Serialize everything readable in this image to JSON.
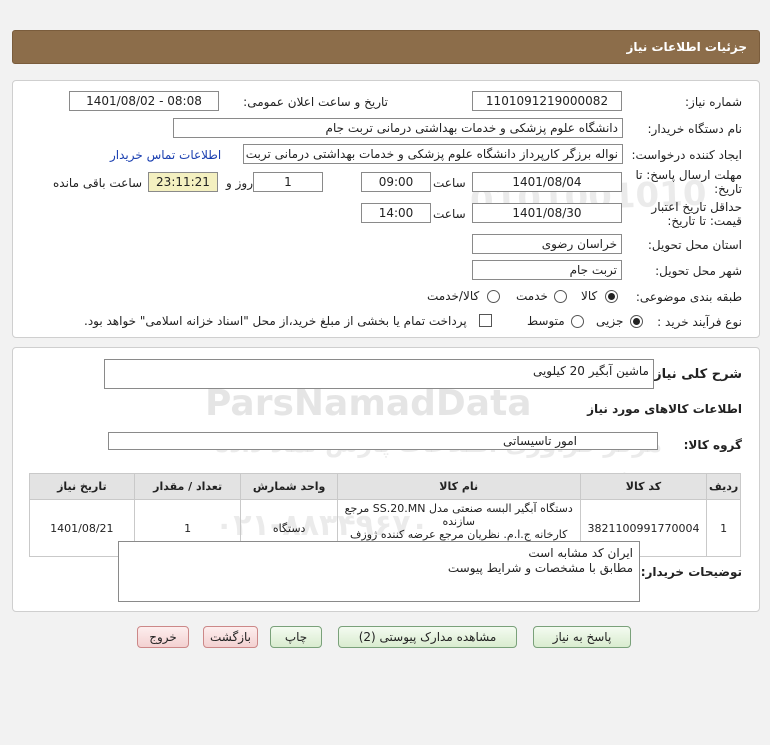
{
  "header": {
    "title": "جزئیات اطلاعات نیاز"
  },
  "details": {
    "need_number_label": "شماره نیاز:",
    "need_number": "1101091219000082",
    "announce_label": "تاریخ و ساعت اعلان عمومی:",
    "announce_value": "1401/08/02 - 08:08",
    "buyer_label": "نام دستگاه خریدار:",
    "buyer_value": "دانشگاه علوم پزشکی و خدمات بهداشتی  درمانی تربت جام",
    "creator_label": "ایجاد کننده درخواست:",
    "creator_value": "نواله برزگر کارپرداز دانشگاه علوم پزشکی و خدمات بهداشتی  درمانی تربت جام",
    "contact_link": "اطلاعات تماس خریدار",
    "deadline_label_1": "مهلت ارسال پاسخ: تا",
    "deadline_label_2": "تاریخ:",
    "deadline_date": "1401/08/04",
    "time_label": "ساعت",
    "deadline_time": "09:00",
    "days_value": "1",
    "days_label": "روز و",
    "remaining_value": "23:11:21",
    "remaining_label": "ساعت باقی مانده",
    "validity_label_1": "حداقل تاریخ اعتبار",
    "validity_label_2": "قیمت: تا تاریخ:",
    "validity_date": "1401/08/30",
    "validity_time_label": "ساعت",
    "validity_time": "14:00",
    "province_label": "استان محل تحویل:",
    "province_value": "خراسان رضوی",
    "city_label": "شهر محل تحویل:",
    "city_value": "تربت جام",
    "category_label": "طبقه بندی موضوعی:",
    "category_options": [
      "کالا",
      "خدمت",
      "کالا/خدمت"
    ],
    "process_label": "نوع فرآیند خرید :",
    "process_options": [
      "جزیی",
      "متوسط"
    ],
    "payment_note": "پرداخت تمام یا بخشی از مبلغ خرید،از محل \"اسناد خزانه اسلامی\" خواهد بود."
  },
  "summary": {
    "desc_label": "شرح کلی نیاز:",
    "desc_value": "ماشین آبگیر 20 کیلویی",
    "goods_info_title": "اطلاعات کالاهای مورد نیاز",
    "group_label": "گروه کالا:",
    "group_value": "امور تاسیساتی"
  },
  "table": {
    "headers": [
      "ردیف",
      "کد کالا",
      "نام کالا",
      "واحد شمارش",
      "تعداد / مقدار",
      "تاریخ نیاز"
    ],
    "rows": [
      {
        "index": "1",
        "code": "3821100991770004",
        "name_line1": "دستگاه آبگیر البسه صنعتی مدل SS.20.MN مرجع سازنده",
        "name_line2": "کارخانه ج.ا.م. نظریان مرجع عرضه کننده ژوزف نظریان",
        "unit": "دستگاه",
        "qty": "1",
        "date": "1401/08/21"
      }
    ]
  },
  "buyer_notes": {
    "label": "توضیحات خریدار:",
    "line1": "ایران کد مشابه است",
    "line2": "مطابق با مشخصات و شرایط پیوست"
  },
  "buttons": {
    "reply": "پاسخ به نیاز",
    "docs": "مشاهده مدارک پیوستی (2)",
    "print": "چاپ",
    "back": "بازگشت",
    "exit": "خروج"
  },
  "watermark": {
    "brand": "ParsNamadData",
    "line1": "مرکز فراوری اطلاعات پارس نماد داده",
    "line2": "پایگاه اطلاع رسانی مناقصات و مزایده",
    "phone": "۰۲۱-۸۸۳۴۹۶۷۰",
    "num": "0101001010"
  },
  "colors": {
    "header_bg": "#8c6d4a",
    "link": "#1a3fb0",
    "remaining_bg": "#f4f0c0"
  }
}
